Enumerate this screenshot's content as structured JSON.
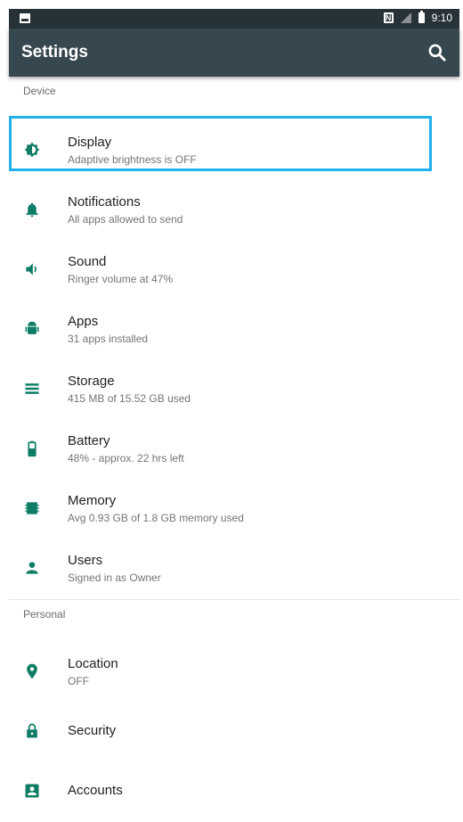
{
  "status": {
    "time": "9:10",
    "nfc_label": "N"
  },
  "app_bar": {
    "title": "Settings",
    "search_icon": "search-icon"
  },
  "sections": {
    "device": {
      "header": "Device",
      "items": [
        {
          "label": "Display",
          "sub": "Adaptive brightness is OFF",
          "icon": "brightness-icon"
        },
        {
          "label": "Notifications",
          "sub": "All apps allowed to send",
          "icon": "bell-icon"
        },
        {
          "label": "Sound",
          "sub": "Ringer volume at 47%",
          "icon": "volume-icon"
        },
        {
          "label": "Apps",
          "sub": "31 apps installed",
          "icon": "android-icon"
        },
        {
          "label": "Storage",
          "sub": "415 MB of 15.52 GB used",
          "icon": "storage-icon"
        },
        {
          "label": "Battery",
          "sub": "48% - approx. 22 hrs left",
          "icon": "battery-icon"
        },
        {
          "label": "Memory",
          "sub": "Avg 0.93 GB of 1.8 GB memory used",
          "icon": "memory-icon"
        },
        {
          "label": "Users",
          "sub": "Signed in as Owner",
          "icon": "person-icon"
        }
      ]
    },
    "personal": {
      "header": "Personal",
      "items": [
        {
          "label": "Location",
          "sub": "OFF",
          "icon": "location-pin-icon"
        },
        {
          "label": "Security",
          "icon": "lock-icon"
        },
        {
          "label": "Accounts",
          "icon": "account-box-icon"
        }
      ]
    }
  },
  "colors": {
    "icon": "#0f7c66",
    "app_bar": "#37474f",
    "status_bar": "#263238",
    "highlight": "#1fb1ea"
  }
}
